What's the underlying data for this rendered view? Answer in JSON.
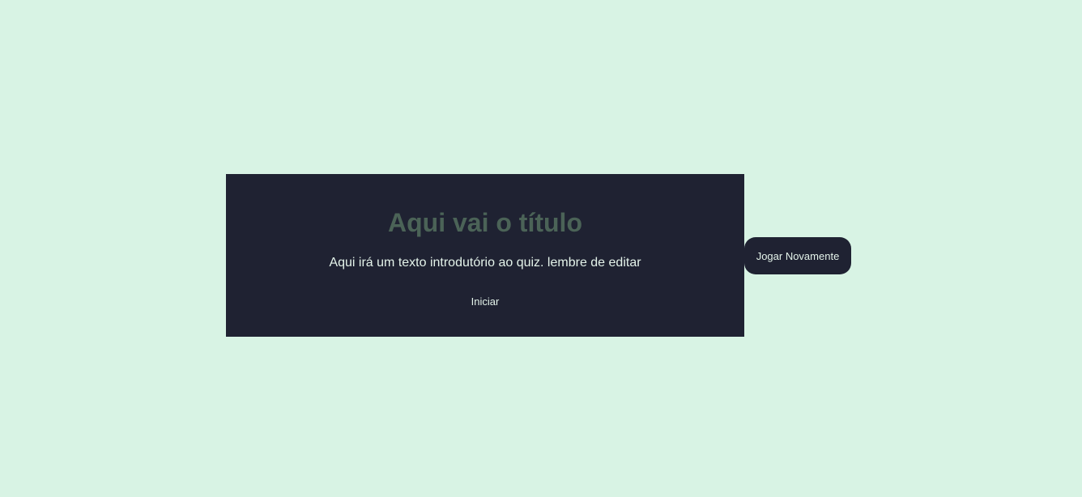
{
  "quiz": {
    "title": "Aqui vai o título",
    "intro": "Aqui irá um texto introdutório ao quiz. lembre de editar",
    "start_label": "Iniciar",
    "play_again_label": "Jogar Novamente"
  },
  "colors": {
    "page_background": "#d8f3e4",
    "card_background": "#1f2232",
    "title_text": "#4b6357",
    "body_text": "#e4f3ea"
  }
}
